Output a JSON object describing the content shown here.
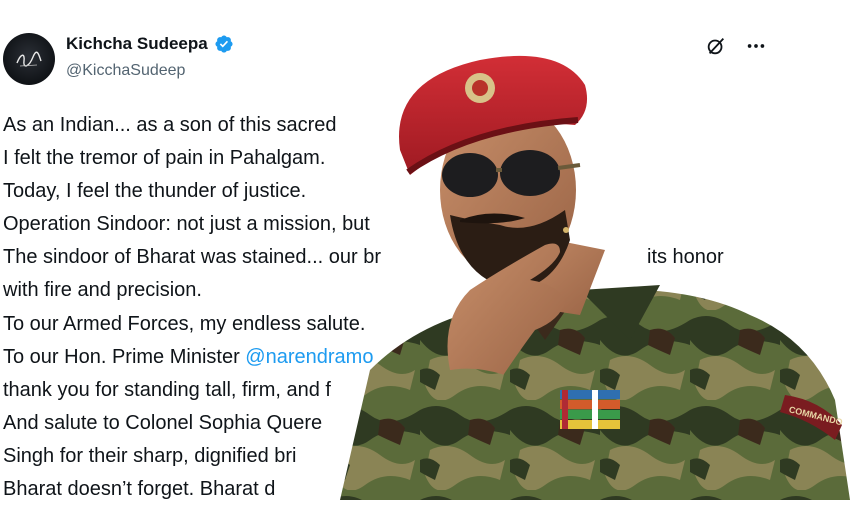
{
  "author": {
    "display_name": "Kichcha Sudeepa",
    "handle": "@KicchaSudeep",
    "verified": true,
    "avatar_icon": "avatar-signature-icon"
  },
  "actions": {
    "grok_icon": "grok-icon",
    "more_icon": "more-icon"
  },
  "tweet": {
    "lines": [
      "As an Indian... as a son of this sacred",
      "I felt the tremor of pain in Pahalgam.",
      "Today, I feel the thunder of justice.",
      "Operation Sindoor: not just a mission, but",
      "The sindoor of Bharat was stained... our br",
      "with fire and precision.",
      "To our Armed Forces, my endless salute.",
      "To our Hon. Prime Minister ",
      "thank you for standing tall, firm, and f",
      "And salute to Colonel Sophia Quere",
      "Singh for their sharp, dignified bri",
      "Bharat doesn’t forget. Bharat d"
    ],
    "line5_tail": "its honor",
    "mention": "@narendramo"
  },
  "photo": {
    "subject": "man-in-army-uniform",
    "beret_color": "#c0242c",
    "shoulder_tab_text": "COMMANDO"
  },
  "colors": {
    "accent": "#1d9bf0",
    "text": "#0f1419",
    "muted": "#536471"
  }
}
